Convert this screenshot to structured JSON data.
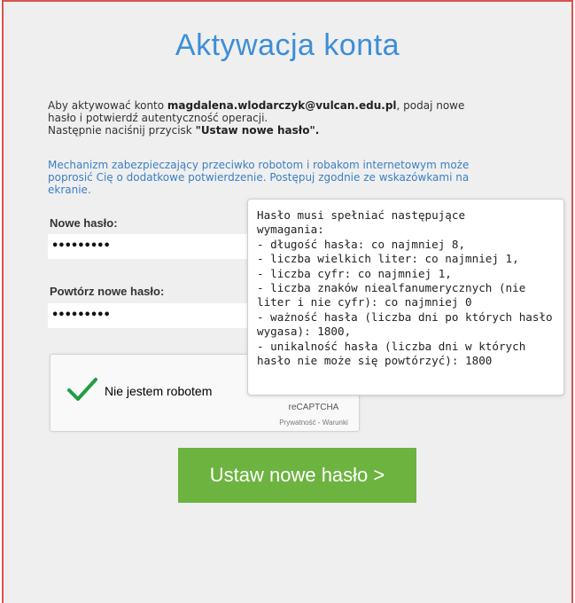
{
  "page": {
    "title": "Aktywacja konta"
  },
  "intro": {
    "part1": "Aby aktywować konto ",
    "email": "magdalena.wlodarczyk@vulcan.edu.pl",
    "part2": ", podaj nowe",
    "line2": "hasło i potwierdź autentyczność operacji.",
    "line3_prefix": "Następnie naciśnij przycisk ",
    "line3_button": "\"Ustaw nowe hasło\"."
  },
  "notice": {
    "line1": "Mechanizm zabezpieczający przeciwko robotom i robakom internetowym może",
    "line2": "poprosić Cię o dodatkowe potwierdzenie. Postępuj zgodnie ze wskazówkami na",
    "line3": "ekranie."
  },
  "form": {
    "new_password_label": "Nowe hasło:",
    "new_password_value": "•••••••••",
    "repeat_password_label": "Powtórz nowe hasło:",
    "repeat_password_value": "•••••••••"
  },
  "captcha": {
    "label": "Nie jestem robotem",
    "brand": "reCAPTCHA",
    "links": "Prywatność - Warunki",
    "check_color": "#1e9e43"
  },
  "submit": {
    "label": "Ustaw nowe hasło >"
  },
  "tooltip": {
    "lines": [
      "Hasło musi spełniać następujące",
      "wymagania:",
      "- długość hasła: co najmniej 8,",
      "- liczba wielkich liter: co najmniej 1,",
      "- liczba cyfr: co najmniej 1,",
      "- liczba znaków niealfanumerycznych (nie",
      "liter i nie cyfr): co najmniej 0",
      "- ważność hasła (liczba dni po których hasło",
      "wygasa): 1800,",
      "- unikalność hasła (liczba dni w których",
      "hasło nie może się powtórzyć): 1800"
    ]
  },
  "colors": {
    "accent": "#3d8ed8",
    "button": "#6cb33f",
    "border": "#d9534f"
  }
}
